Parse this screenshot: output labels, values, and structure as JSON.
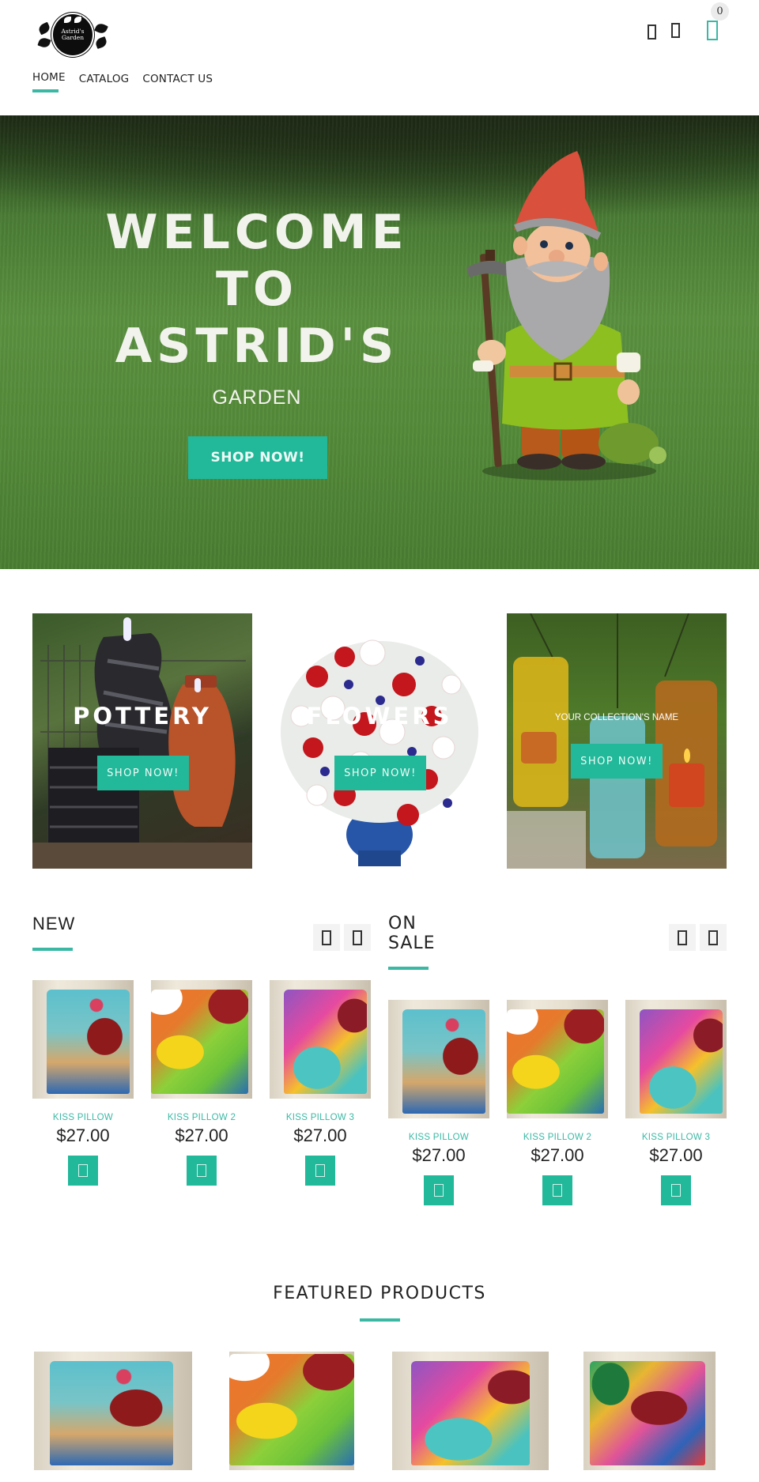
{
  "brand": {
    "logo_text_line1": "Astrid's",
    "logo_text_line2": "Garden",
    "accent_color": "#3bb8a4",
    "button_color": "#22b89a"
  },
  "header": {
    "icons": [
      "account-icon",
      "search-icon",
      "cart-icon"
    ],
    "cart_count": "0"
  },
  "nav": {
    "items": [
      {
        "label": "HOME",
        "active": true
      },
      {
        "label": "CATALOG",
        "active": false
      },
      {
        "label": "CONTACT US",
        "active": false
      }
    ]
  },
  "hero": {
    "title_line1": "WELCOME",
    "title_line2": "TO",
    "title_line3": "ASTRID'S",
    "subtitle": "GARDEN",
    "button_label": "SHOP NOW!"
  },
  "collections": [
    {
      "title": "POTTERY",
      "button_label": "SHOP NOW!"
    },
    {
      "title": "FLOWERS",
      "button_label": "SHOP NOW!"
    },
    {
      "title": "YOUR COLLECTION'S NAME",
      "button_label": "SHOP NOW!"
    }
  ],
  "sections": {
    "new": {
      "title": "NEW",
      "products": [
        {
          "name": "KISS PILLOW",
          "price": "$27.00"
        },
        {
          "name": "KISS PILLOW 2",
          "price": "$27.00"
        },
        {
          "name": "KISS PILLOW 3",
          "price": "$27.00"
        }
      ]
    },
    "on_sale": {
      "title_line1": "ON",
      "title_line2": "SALE",
      "products": [
        {
          "name": "KISS PILLOW",
          "price": "$27.00"
        },
        {
          "name": "KISS PILLOW 2",
          "price": "$27.00"
        },
        {
          "name": "KISS PILLOW 3",
          "price": "$27.00"
        }
      ]
    },
    "featured": {
      "title": "FEATURED PRODUCTS"
    }
  }
}
